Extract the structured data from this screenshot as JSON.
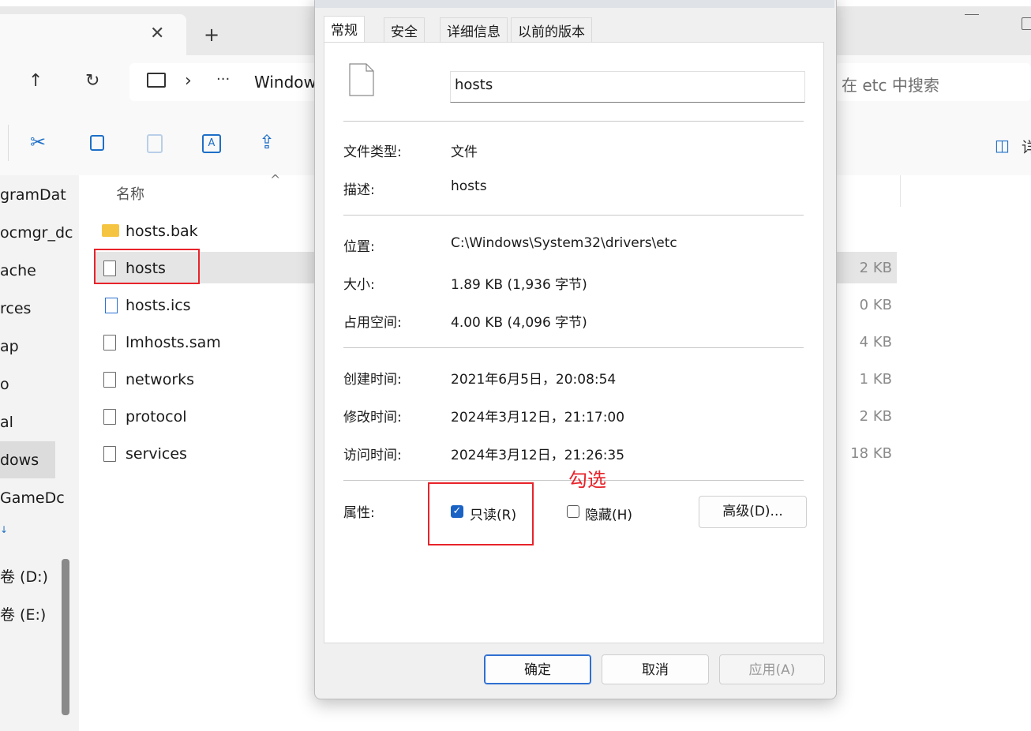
{
  "explorer": {
    "tab_close": "✕",
    "new_tab": "+",
    "address_ellipsis": "···",
    "address_chevron": "›",
    "address_text": "Window",
    "search_placeholder": "在 etc 中搜索",
    "preview_text": "详",
    "column_name": "名称",
    "sidebar": [
      "gramDat",
      "ocmgr_dc",
      "ache",
      "rces",
      "ap",
      "o",
      "al",
      "dows",
      "GameDc",
      "↓",
      "卷 (D:)",
      "卷 (E:)"
    ],
    "files": [
      {
        "name": "hosts.bak",
        "size": "",
        "icon": "folder-icon"
      },
      {
        "name": "hosts",
        "size": "2 KB",
        "icon": "file-icon"
      },
      {
        "name": "hosts.ics",
        "size": "0 KB",
        "icon": "ics-file-icon"
      },
      {
        "name": "lmhosts.sam",
        "size": "4 KB",
        "icon": "file-icon"
      },
      {
        "name": "networks",
        "size": "1 KB",
        "icon": "file-icon"
      },
      {
        "name": "protocol",
        "size": "2 KB",
        "icon": "file-icon"
      },
      {
        "name": "services",
        "size": "18 KB",
        "icon": "file-icon"
      }
    ]
  },
  "dialog": {
    "tabs": [
      "常规",
      "安全",
      "详细信息",
      "以前的版本"
    ],
    "file_name": "hosts",
    "file_type_label": "文件类型:",
    "file_type_value": "文件",
    "description_label": "描述:",
    "description_value": "hosts",
    "location_label": "位置:",
    "location_value": "C:\\Windows\\System32\\drivers\\etc",
    "size_label": "大小:",
    "size_value": "1.89 KB (1,936 字节)",
    "size_on_disk_label": "占用空间:",
    "size_on_disk_value": "4.00 KB (4,096 字节)",
    "created_label": "创建时间:",
    "created_value": "2021年6月5日，20:08:54",
    "modified_label": "修改时间:",
    "modified_value": "2024年3月12日，21:17:00",
    "accessed_label": "访问时间:",
    "accessed_value": "2024年3月12日，21:26:35",
    "attributes_label": "属性:",
    "readonly_label": "只读(R)",
    "readonly_checked": true,
    "hidden_label": "隐藏(H)",
    "hidden_checked": false,
    "advanced_button": "高级(D)...",
    "ok_button": "确定",
    "cancel_button": "取消",
    "apply_button": "应用(A)"
  },
  "annotation": {
    "text": "勾选",
    "color": "#e8232a"
  },
  "colors": {
    "accent": "#1a63c5",
    "highlight_box": "#e8232a"
  }
}
